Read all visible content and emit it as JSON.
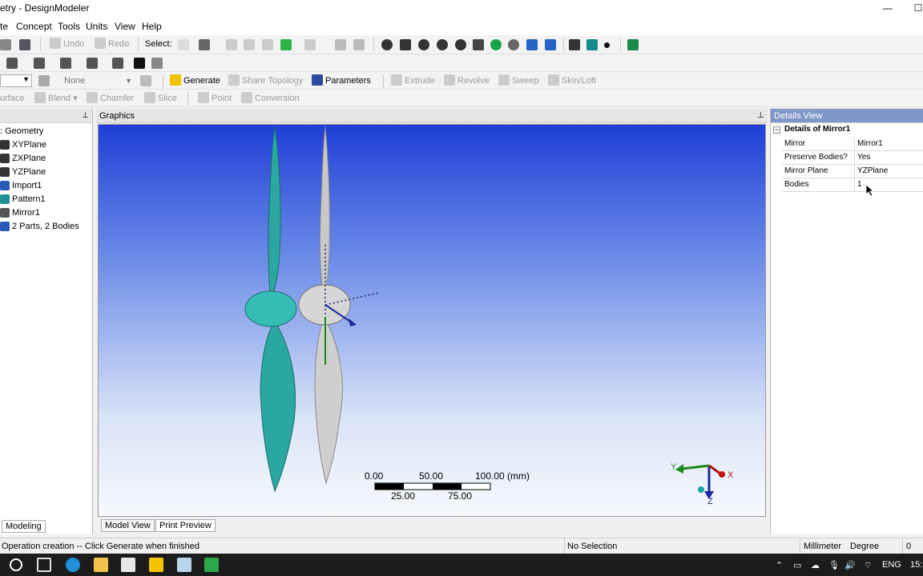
{
  "window": {
    "title": "etry - DesignModeler",
    "minimize": "—",
    "maximize": "☐"
  },
  "menu": [
    "te",
    "Concept",
    "Tools",
    "Units",
    "View",
    "Help"
  ],
  "toolbar1": {
    "undo": "Undo",
    "redo": "Redo",
    "select": "Select:"
  },
  "toolbar3": {
    "none_select": "None",
    "generate": "Generate",
    "share_topology": "Share Topology",
    "parameters": "Parameters",
    "extrude": "Extrude",
    "revolve": "Revolve",
    "sweep": "Sweep",
    "skin_loft": "Skin/Loft"
  },
  "toolbar4": {
    "surface": "urface",
    "blend": "Blend",
    "chamfer": "Chamfer",
    "slice": "Slice",
    "point": "Point",
    "conversion": "Conversion"
  },
  "tree": {
    "pin": "📌",
    "root": ": Geometry",
    "items": [
      "XYPlane",
      "ZXPlane",
      "YZPlane",
      "Import1",
      "Pattern1",
      "Mirror1",
      "2 Parts, 2 Bodies"
    ],
    "tab": "Modeling"
  },
  "graphics": {
    "title": "Graphics",
    "scale": {
      "t0": "0.00",
      "t50": "50.00",
      "t100": "100.00 (mm)",
      "t25": "25.00",
      "t75": "75.00"
    },
    "triad": {
      "x": "X",
      "y": "Y",
      "z": "Z"
    },
    "tabs": [
      "Model View",
      "Print Preview"
    ]
  },
  "details": {
    "title": "Details View",
    "section": "Details of Mirror1",
    "rows": [
      {
        "k": "Mirror",
        "v": "Mirror1"
      },
      {
        "k": "Preserve Bodies?",
        "v": "Yes"
      },
      {
        "k": "Mirror Plane",
        "v": "YZPlane"
      },
      {
        "k": "Bodies",
        "v": "1"
      }
    ]
  },
  "status": {
    "message": "Operation creation -- Click Generate when finished",
    "selection": "No Selection",
    "units": "Millimeter",
    "angle": "Degree",
    "value": "0"
  },
  "taskbar": {
    "lang": "ENG",
    "time": "15:"
  },
  "colors": {
    "viewport_top": "#1f3fd7",
    "blade_teal": "#2aa7a0",
    "blade_grey": "#c8c8c8",
    "details_header": "#7f97c9"
  }
}
